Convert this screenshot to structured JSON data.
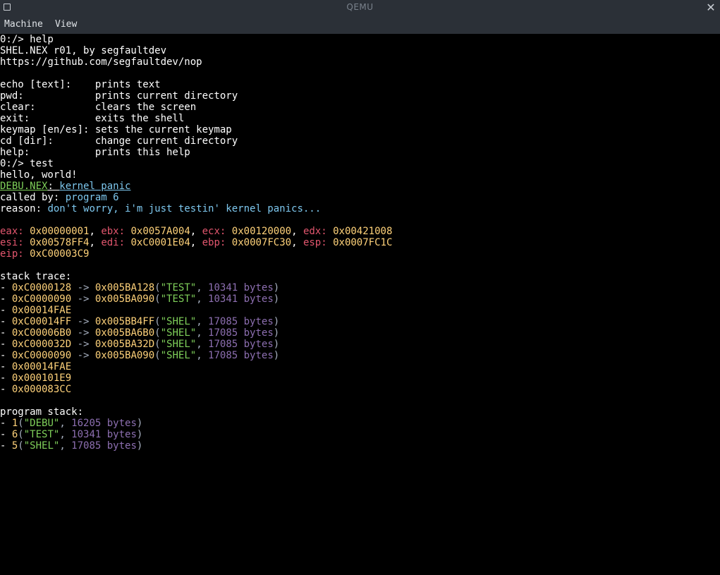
{
  "window": {
    "title": "QEMU",
    "menu": [
      "Machine",
      "View"
    ]
  },
  "colors": {
    "titlebar_bg": "#2b3037",
    "terminal_bg": "#000000",
    "white": "#ffffff",
    "green": "#7fd05a",
    "cyan": "#7ec8ef",
    "red": "#e2566e",
    "yellow": "#ffd27a",
    "purple": "#8d6fb1"
  },
  "icons": {
    "left": "window-menu-icon",
    "right": "close-icon"
  },
  "terminal": {
    "lines": [
      [
        {
          "t": "0:/> help",
          "c": "white"
        }
      ],
      [
        {
          "t": "SHEL.NEX r01, by segfaultdev",
          "c": "white"
        }
      ],
      [
        {
          "t": "https://github.com/segfaultdev/nop",
          "c": "white"
        }
      ],
      [
        {
          "t": "",
          "c": "white"
        }
      ],
      [
        {
          "t": "echo [text]:    prints text",
          "c": "white"
        }
      ],
      [
        {
          "t": "pwd:            prints current directory",
          "c": "white"
        }
      ],
      [
        {
          "t": "clear:          clears the screen",
          "c": "white"
        }
      ],
      [
        {
          "t": "exit:           exits the shell",
          "c": "white"
        }
      ],
      [
        {
          "t": "keymap [en/es]: sets the current keymap",
          "c": "white"
        }
      ],
      [
        {
          "t": "cd [dir]:       change current directory",
          "c": "white"
        }
      ],
      [
        {
          "t": "help:           prints this help",
          "c": "white"
        }
      ],
      [
        {
          "t": "0:/> test",
          "c": "white"
        }
      ],
      [
        {
          "t": "hello, world!",
          "c": "white"
        }
      ],
      [
        {
          "t": "DEBU.NEX",
          "c": "green",
          "u": true
        },
        {
          "t": ": ",
          "c": "white",
          "u": true
        },
        {
          "t": "kernel panic",
          "c": "cyan",
          "u": true
        }
      ],
      [
        {
          "t": "called by: ",
          "c": "white"
        },
        {
          "t": "program 6",
          "c": "cyan"
        }
      ],
      [
        {
          "t": "reason: ",
          "c": "white"
        },
        {
          "t": "don't worry, i'm just testin' kernel panics...",
          "c": "cyan"
        }
      ],
      [
        {
          "t": "",
          "c": "white"
        }
      ],
      [
        {
          "t": "eax: ",
          "c": "red"
        },
        {
          "t": "0x00000001",
          "c": "yellow"
        },
        {
          "t": ", ",
          "c": "white"
        },
        {
          "t": "ebx: ",
          "c": "red"
        },
        {
          "t": "0x0057A004",
          "c": "yellow"
        },
        {
          "t": ", ",
          "c": "white"
        },
        {
          "t": "ecx: ",
          "c": "red"
        },
        {
          "t": "0x00120000",
          "c": "yellow"
        },
        {
          "t": ", ",
          "c": "white"
        },
        {
          "t": "edx: ",
          "c": "red"
        },
        {
          "t": "0x00421008",
          "c": "yellow"
        }
      ],
      [
        {
          "t": "esi: ",
          "c": "red"
        },
        {
          "t": "0x00578FF4",
          "c": "yellow"
        },
        {
          "t": ", ",
          "c": "white"
        },
        {
          "t": "edi: ",
          "c": "red"
        },
        {
          "t": "0xC0001E04",
          "c": "yellow"
        },
        {
          "t": ", ",
          "c": "white"
        },
        {
          "t": "ebp: ",
          "c": "red"
        },
        {
          "t": "0x0007FC30",
          "c": "yellow"
        },
        {
          "t": ", ",
          "c": "white"
        },
        {
          "t": "esp: ",
          "c": "red"
        },
        {
          "t": "0x0007FC1C",
          "c": "yellow"
        }
      ],
      [
        {
          "t": "eip: ",
          "c": "red"
        },
        {
          "t": "0xC00003C9",
          "c": "yellow"
        }
      ],
      [
        {
          "t": "",
          "c": "white"
        }
      ],
      [
        {
          "t": "stack trace:",
          "c": "white"
        }
      ],
      [
        {
          "t": "- ",
          "c": "white"
        },
        {
          "t": "0xC0000128",
          "c": "yellow"
        },
        {
          "t": " -> ",
          "c": "gray"
        },
        {
          "t": "0x005BA128",
          "c": "yellow"
        },
        {
          "t": "(",
          "c": "gray"
        },
        {
          "t": "\"TEST\"",
          "c": "green"
        },
        {
          "t": ", ",
          "c": "gray"
        },
        {
          "t": "10341 bytes",
          "c": "purple"
        },
        {
          "t": ")",
          "c": "gray"
        }
      ],
      [
        {
          "t": "- ",
          "c": "white"
        },
        {
          "t": "0xC0000090",
          "c": "yellow"
        },
        {
          "t": " -> ",
          "c": "gray"
        },
        {
          "t": "0x005BA090",
          "c": "yellow"
        },
        {
          "t": "(",
          "c": "gray"
        },
        {
          "t": "\"TEST\"",
          "c": "green"
        },
        {
          "t": ", ",
          "c": "gray"
        },
        {
          "t": "10341 bytes",
          "c": "purple"
        },
        {
          "t": ")",
          "c": "gray"
        }
      ],
      [
        {
          "t": "- ",
          "c": "white"
        },
        {
          "t": "0x00014FAE",
          "c": "yellow"
        }
      ],
      [
        {
          "t": "- ",
          "c": "white"
        },
        {
          "t": "0xC00014FF",
          "c": "yellow"
        },
        {
          "t": " -> ",
          "c": "gray"
        },
        {
          "t": "0x005BB4FF",
          "c": "yellow"
        },
        {
          "t": "(",
          "c": "gray"
        },
        {
          "t": "\"SHEL\"",
          "c": "green"
        },
        {
          "t": ", ",
          "c": "gray"
        },
        {
          "t": "17085 bytes",
          "c": "purple"
        },
        {
          "t": ")",
          "c": "gray"
        }
      ],
      [
        {
          "t": "- ",
          "c": "white"
        },
        {
          "t": "0xC00006B0",
          "c": "yellow"
        },
        {
          "t": " -> ",
          "c": "gray"
        },
        {
          "t": "0x005BA6B0",
          "c": "yellow"
        },
        {
          "t": "(",
          "c": "gray"
        },
        {
          "t": "\"SHEL\"",
          "c": "green"
        },
        {
          "t": ", ",
          "c": "gray"
        },
        {
          "t": "17085 bytes",
          "c": "purple"
        },
        {
          "t": ")",
          "c": "gray"
        }
      ],
      [
        {
          "t": "- ",
          "c": "white"
        },
        {
          "t": "0xC000032D",
          "c": "yellow"
        },
        {
          "t": " -> ",
          "c": "gray"
        },
        {
          "t": "0x005BA32D",
          "c": "yellow"
        },
        {
          "t": "(",
          "c": "gray"
        },
        {
          "t": "\"SHEL\"",
          "c": "green"
        },
        {
          "t": ", ",
          "c": "gray"
        },
        {
          "t": "17085 bytes",
          "c": "purple"
        },
        {
          "t": ")",
          "c": "gray"
        }
      ],
      [
        {
          "t": "- ",
          "c": "white"
        },
        {
          "t": "0xC0000090",
          "c": "yellow"
        },
        {
          "t": " -> ",
          "c": "gray"
        },
        {
          "t": "0x005BA090",
          "c": "yellow"
        },
        {
          "t": "(",
          "c": "gray"
        },
        {
          "t": "\"SHEL\"",
          "c": "green"
        },
        {
          "t": ", ",
          "c": "gray"
        },
        {
          "t": "17085 bytes",
          "c": "purple"
        },
        {
          "t": ")",
          "c": "gray"
        }
      ],
      [
        {
          "t": "- ",
          "c": "white"
        },
        {
          "t": "0x00014FAE",
          "c": "yellow"
        }
      ],
      [
        {
          "t": "- ",
          "c": "white"
        },
        {
          "t": "0x000101E9",
          "c": "yellow"
        }
      ],
      [
        {
          "t": "- ",
          "c": "white"
        },
        {
          "t": "0x000083CC",
          "c": "yellow"
        }
      ],
      [
        {
          "t": "",
          "c": "white"
        }
      ],
      [
        {
          "t": "program stack:",
          "c": "white"
        }
      ],
      [
        {
          "t": "- ",
          "c": "white"
        },
        {
          "t": "1",
          "c": "yellow"
        },
        {
          "t": "(",
          "c": "gray"
        },
        {
          "t": "\"DEBU\"",
          "c": "green"
        },
        {
          "t": ", ",
          "c": "gray"
        },
        {
          "t": "16205 bytes",
          "c": "purple"
        },
        {
          "t": ")",
          "c": "gray"
        }
      ],
      [
        {
          "t": "- ",
          "c": "white"
        },
        {
          "t": "6",
          "c": "yellow"
        },
        {
          "t": "(",
          "c": "gray"
        },
        {
          "t": "\"TEST\"",
          "c": "green"
        },
        {
          "t": ", ",
          "c": "gray"
        },
        {
          "t": "10341 bytes",
          "c": "purple"
        },
        {
          "t": ")",
          "c": "gray"
        }
      ],
      [
        {
          "t": "- ",
          "c": "white"
        },
        {
          "t": "5",
          "c": "yellow"
        },
        {
          "t": "(",
          "c": "gray"
        },
        {
          "t": "\"SHEL\"",
          "c": "green"
        },
        {
          "t": ", ",
          "c": "gray"
        },
        {
          "t": "17085 bytes",
          "c": "purple"
        },
        {
          "t": ")",
          "c": "gray"
        }
      ]
    ]
  }
}
